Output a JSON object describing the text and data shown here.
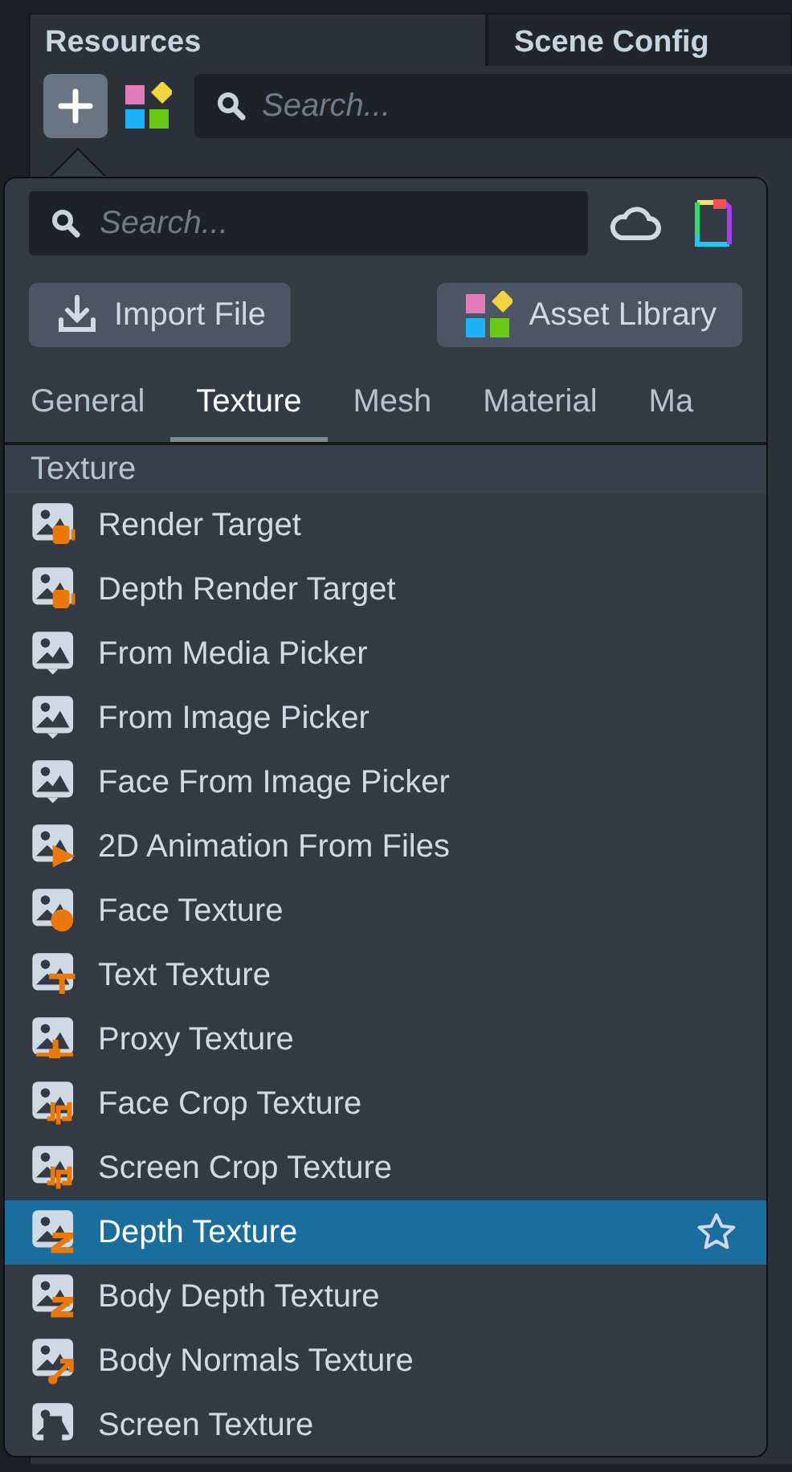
{
  "panel_tabs": [
    {
      "label": "Resources",
      "selected": true
    },
    {
      "label": "Scene Config",
      "selected": false
    }
  ],
  "toolbar": {
    "search": {
      "placeholder": "Search..."
    }
  },
  "popup": {
    "search": {
      "placeholder": "Search..."
    },
    "buttons": [
      {
        "label": "Import File",
        "kind": "import"
      },
      {
        "label": "Asset Library",
        "kind": "library"
      }
    ],
    "tabs": [
      {
        "label": "General",
        "selected": false
      },
      {
        "label": "Texture",
        "selected": true
      },
      {
        "label": "Mesh",
        "selected": false
      },
      {
        "label": "Material",
        "selected": false
      },
      {
        "label": "Ma",
        "selected": false
      }
    ],
    "section": "Texture",
    "items": [
      {
        "label": "Render Target",
        "selected": false
      },
      {
        "label": "Depth Render Target",
        "selected": false
      },
      {
        "label": "From Media Picker",
        "selected": false
      },
      {
        "label": "From Image Picker",
        "selected": false
      },
      {
        "label": "Face From Image Picker",
        "selected": false
      },
      {
        "label": "2D Animation From Files",
        "selected": false
      },
      {
        "label": "Face Texture",
        "selected": false
      },
      {
        "label": "Text Texture",
        "selected": false
      },
      {
        "label": "Proxy Texture",
        "selected": false
      },
      {
        "label": "Face Crop Texture",
        "selected": false
      },
      {
        "label": "Screen Crop Texture",
        "selected": false
      },
      {
        "label": "Depth Texture",
        "selected": true
      },
      {
        "label": "Body Depth Texture",
        "selected": false
      },
      {
        "label": "Body Normals Texture",
        "selected": false
      },
      {
        "label": "Screen Texture",
        "selected": false
      }
    ]
  }
}
